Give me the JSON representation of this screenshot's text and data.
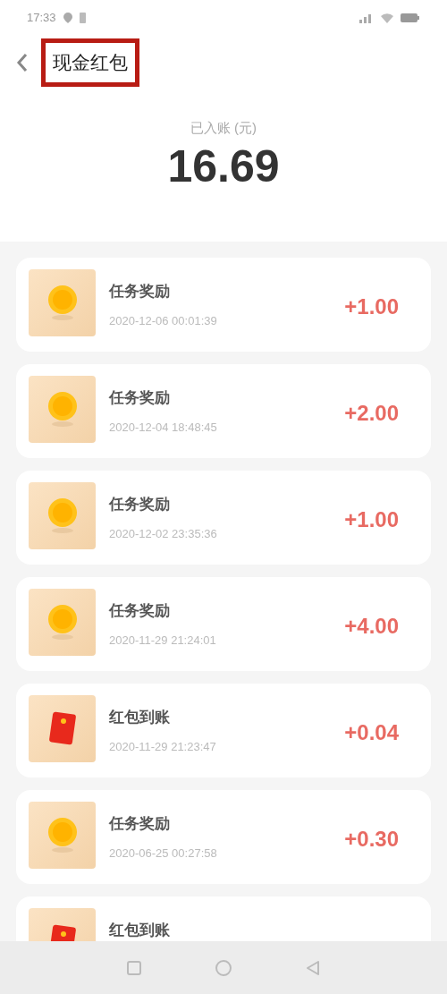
{
  "status_bar": {
    "time": "17:33"
  },
  "header": {
    "title": "现金红包",
    "highlighted": true
  },
  "summary": {
    "label": "已入账 (元)",
    "amount": "16.69"
  },
  "records": [
    {
      "kind": "coin",
      "title": "任务奖励",
      "time": "2020-12-06 00:01:39",
      "amount": "+1.00"
    },
    {
      "kind": "coin",
      "title": "任务奖励",
      "time": "2020-12-04 18:48:45",
      "amount": "+2.00"
    },
    {
      "kind": "coin",
      "title": "任务奖励",
      "time": "2020-12-02 23:35:36",
      "amount": "+1.00"
    },
    {
      "kind": "coin",
      "title": "任务奖励",
      "time": "2020-11-29 21:24:01",
      "amount": "+4.00"
    },
    {
      "kind": "envelope",
      "title": "红包到账",
      "time": "2020-11-29 21:23:47",
      "amount": "+0.04"
    },
    {
      "kind": "coin",
      "title": "任务奖励",
      "time": "2020-06-25 00:27:58",
      "amount": "+0.30"
    },
    {
      "kind": "envelope",
      "title": "红包到账"
    }
  ]
}
